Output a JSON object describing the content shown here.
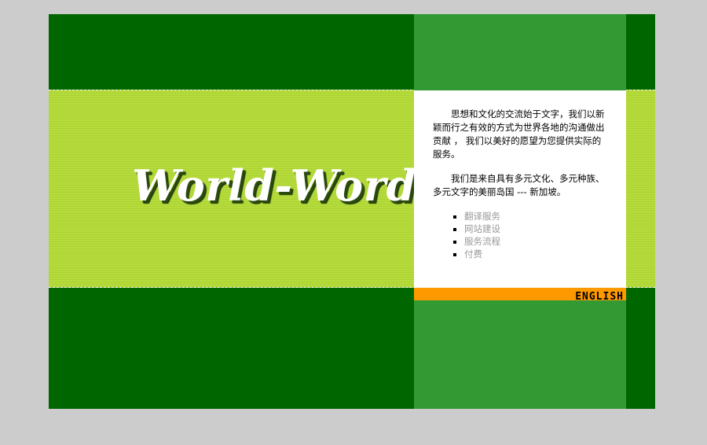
{
  "header": {
    "logo_text": "World-Word"
  },
  "intro": {
    "paragraph_1": "思想和文化的交流始于文字，我们以新颖而行之有效的方式为世界各地的沟通做出贡献 ， 我们以美好的愿望为您提供实际的服务。",
    "paragraph_2": "我们是来自具有多元文化、多元种族、多元文字的美丽岛国 --- 新加坡。"
  },
  "nav": {
    "items": [
      {
        "label": "翻译服务"
      },
      {
        "label": "网站建设"
      },
      {
        "label": "服务流程"
      },
      {
        "label": "付费"
      }
    ]
  },
  "language": {
    "label": "ENGLISH"
  },
  "colors": {
    "background": "#cccccc",
    "dark_green": "#006600",
    "mid_green": "#339933",
    "lime": "#b5dc3a",
    "orange": "#ff9900",
    "link_gray": "#999999"
  }
}
